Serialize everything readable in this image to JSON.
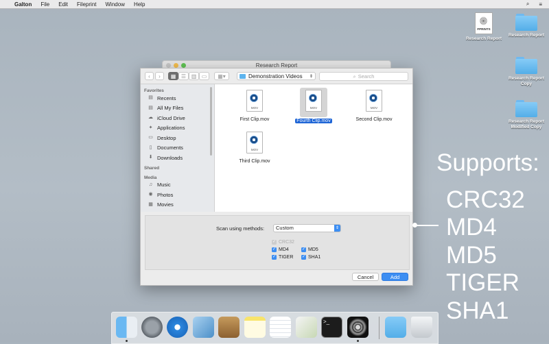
{
  "menubar": {
    "apple": "",
    "app_name": "Galton",
    "items": [
      "File",
      "Edit",
      "Fileprint",
      "Window",
      "Help"
    ],
    "spotlight_icon": "⌕",
    "menu_icon": "≡"
  },
  "desktop": {
    "items": [
      {
        "label": "Research Report",
        "icon": "fingerprint-doc",
        "badge": "FPRINTS"
      },
      {
        "label": "Research Report",
        "icon": "folder"
      },
      {
        "label": "Research Report Copy",
        "icon": "folder"
      },
      {
        "label": "Research Report Modified Copy",
        "icon": "folder"
      }
    ]
  },
  "background_window": {
    "title": "Research Report"
  },
  "dialog": {
    "nav": {
      "back": "‹",
      "forward": "›"
    },
    "view_icons": [
      "▦",
      "☰",
      "▥",
      "▭"
    ],
    "arrange_icon": "▦",
    "location": "Demonstration Videos",
    "search_placeholder": "Search",
    "sidebar": {
      "favorites_header": "Favorites",
      "favorites": [
        {
          "label": "Recents",
          "icon": "▤"
        },
        {
          "label": "All My Files",
          "icon": "▤"
        },
        {
          "label": "iCloud Drive",
          "icon": "☁"
        },
        {
          "label": "Applications",
          "icon": "✦"
        },
        {
          "label": "Desktop",
          "icon": "▭"
        },
        {
          "label": "Documents",
          "icon": "▯"
        },
        {
          "label": "Downloads",
          "icon": "⬇"
        }
      ],
      "shared_header": "Shared",
      "media_header": "Media",
      "media": [
        {
          "label": "Music",
          "icon": "♫"
        },
        {
          "label": "Photos",
          "icon": "◉"
        },
        {
          "label": "Movies",
          "icon": "▦"
        }
      ]
    },
    "files": [
      {
        "name": "First Clip.mov",
        "type": "MOV"
      },
      {
        "name": "Fourth Clip.mov",
        "type": "MOV",
        "selected": true
      },
      {
        "name": "Second Clip.mov",
        "type": "MOV"
      },
      {
        "name": "Third Clip.mov",
        "type": "MOV"
      }
    ],
    "options": {
      "scan_label": "Scan using methods:",
      "scan_value": "Custom",
      "checkboxes": [
        {
          "label": "CRC32",
          "checked": true,
          "enabled": false
        },
        {
          "label": "MD4",
          "checked": true,
          "enabled": true
        },
        {
          "label": "MD5",
          "checked": true,
          "enabled": true
        },
        {
          "label": "TIGER",
          "checked": true,
          "enabled": true
        },
        {
          "label": "SHA1",
          "checked": true,
          "enabled": true
        }
      ]
    },
    "cancel_label": "Cancel",
    "add_label": "Add"
  },
  "callout": {
    "title": "Supports:",
    "methods": [
      "CRC32",
      "MD4",
      "MD5",
      "TIGER",
      "SHA1"
    ]
  },
  "dock": {
    "apps": [
      "finder",
      "launchpad",
      "safari",
      "preview",
      "contacts",
      "notes",
      "reminders",
      "textedit",
      "terminal",
      "galton",
      "downloads",
      "trash"
    ]
  },
  "colors": {
    "accent": "#3d8ef2",
    "selection": "#1e65d6",
    "folder": "#5db4ee"
  }
}
